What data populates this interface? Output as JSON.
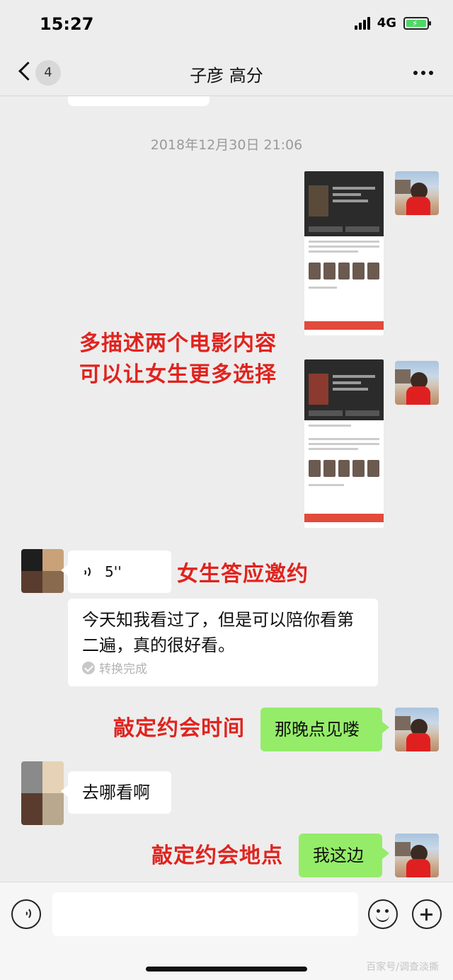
{
  "status_bar": {
    "time": "15:27",
    "network": "4G"
  },
  "nav": {
    "badge_count": "4",
    "title": "子彦 高分"
  },
  "timestamp": "2018年12月30日 21:06",
  "annotations": {
    "line1": "多描述两个电影内容",
    "line2": "可以让女生更多选择",
    "accept": "女生答应邀约",
    "time": "敲定约会时间",
    "place": "敲定约会地点"
  },
  "messages": {
    "voice_duration": "5''",
    "transcript": "今天知我看过了，但是可以陪你看第二遍，真的很好看。",
    "transcript_status": "转换完成",
    "reply_time": "那晚点见喽",
    "her_question": "去哪看啊",
    "reply_place": "我这边"
  },
  "watermark": "百家号/调查淡撕",
  "colors": {
    "annotation": "#e0231e",
    "outgoing_bubble": "#95ec69",
    "background": "#ededed"
  }
}
